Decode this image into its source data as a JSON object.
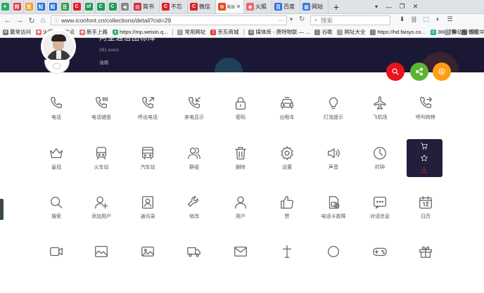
{
  "browser": {
    "tabs": [
      {
        "kind": "narrow",
        "fav": "●",
        "color": "#2aae67",
        "label": ""
      },
      {
        "kind": "narrow",
        "fav": "邦",
        "color": "#e03a3a",
        "label": ""
      },
      {
        "kind": "narrow",
        "fav": "货",
        "color": "#f0a020",
        "label": ""
      },
      {
        "kind": "narrow",
        "fav": "知",
        "color": "#1b6fe0",
        "label": ""
      },
      {
        "kind": "narrow",
        "fav": "知",
        "color": "#1b6fe0",
        "label": ""
      },
      {
        "kind": "narrow",
        "fav": "豆",
        "color": "#2e963d",
        "label": ""
      },
      {
        "kind": "narrow",
        "fav": "C",
        "color": "#d22",
        "label": ""
      },
      {
        "kind": "narrow",
        "fav": "sf",
        "color": "#1a9d55",
        "label": ""
      },
      {
        "kind": "narrow",
        "fav": "C",
        "color": "#1a9d55",
        "label": ""
      },
      {
        "kind": "narrow",
        "fav": "C",
        "color": "#1a9d55",
        "label": ""
      },
      {
        "kind": "narrow",
        "fav": "◀",
        "color": "#888",
        "label": ""
      },
      {
        "kind": "wide",
        "fav": "▤",
        "color": "#c33",
        "label": "简书"
      },
      {
        "kind": "wide",
        "fav": "C",
        "color": "#d22",
        "label": "不忘"
      },
      {
        "kind": "wide",
        "fav": "C",
        "color": "#d22",
        "label": "微信"
      },
      {
        "kind": "active",
        "fav": "✿",
        "color": "#e64a19",
        "label": "Ico"
      },
      {
        "kind": "wide",
        "fav": "◉",
        "color": "#e66",
        "label": "火狐"
      },
      {
        "kind": "wide",
        "fav": "百",
        "color": "#2b6de0",
        "label": "百度"
      },
      {
        "kind": "wide",
        "fav": "▦",
        "color": "#3a7be0",
        "label": "网站"
      }
    ],
    "new_tab": "+",
    "tab_menu": "▾",
    "window_buttons": [
      "—",
      "❐",
      "✕"
    ],
    "url": "www.iconfont.cn/collections/detail?cid=29",
    "search_placeholder": "搜索",
    "toolbar_icons": [
      "⬇",
      "|||",
      "⬚",
      "◐",
      "☰"
    ],
    "bookmarks": [
      {
        "label": "最常访问",
        "color": "#777",
        "icon": "⚙"
      },
      {
        "label": "火狐官方站点",
        "color": "#e66",
        "icon": "◉"
      },
      {
        "label": "新手上路",
        "color": "#e66",
        "icon": "◉"
      },
      {
        "label": "https://mp.weixin.q...",
        "color": "#2aae67",
        "icon": "●"
      },
      {
        "label": "常用网址",
        "color": "#999",
        "icon": "▢"
      },
      {
        "label": "京东商城",
        "color": "#d22",
        "icon": "京"
      },
      {
        "label": "媒体库 - 唐特物联 — ...",
        "color": "#777",
        "icon": "☰"
      },
      {
        "label": "谷歌",
        "color": "#777",
        "icon": "▢"
      },
      {
        "label": "网址大全",
        "color": "#999",
        "icon": "▢"
      },
      {
        "label": "https://hd.faisys.co...",
        "color": "#777",
        "icon": "▢"
      },
      {
        "label": "360搜索",
        "color": "#2a9",
        "icon": "◎"
      },
      {
        "label": "游戏中心",
        "color": "#777",
        "icon": "▢"
      }
    ],
    "bookmark_more": "移动版书签"
  },
  "collection": {
    "title": "阿里通信图标库",
    "count": "261 icons",
    "author": "油烟"
  },
  "actions": [
    {
      "name": "search",
      "color": "#e8131e"
    },
    {
      "name": "share",
      "color": "#5cb531"
    },
    {
      "name": "download",
      "color": "#ff9e12"
    }
  ],
  "icons": [
    {
      "label": "电话",
      "icon": "phone-icon"
    },
    {
      "label": "电话键盘",
      "icon": "phone-keypad-icon"
    },
    {
      "label": "呼出电话",
      "icon": "phone-outgoing-icon"
    },
    {
      "label": "来电显示",
      "icon": "phone-incoming-icon"
    },
    {
      "label": "密码",
      "icon": "lock-icon"
    },
    {
      "label": "出租车",
      "icon": "taxi-icon"
    },
    {
      "label": "灯泡提示",
      "icon": "lightbulb-icon"
    },
    {
      "label": "飞机场",
      "icon": "airplane-icon"
    },
    {
      "label": "呼叫转移",
      "icon": "call-forward-icon"
    },
    {
      "label": "",
      "icon": "blank"
    },
    {
      "label": "皇冠",
      "icon": "crown-icon"
    },
    {
      "label": "火车站",
      "icon": "train-icon"
    },
    {
      "label": "汽车站",
      "icon": "bus-icon"
    },
    {
      "label": "群组",
      "icon": "group-icon"
    },
    {
      "label": "删除",
      "icon": "trash-icon"
    },
    {
      "label": "设置",
      "icon": "gear-icon"
    },
    {
      "label": "声音",
      "icon": "speaker-icon"
    },
    {
      "label": "时钟",
      "icon": "clock-icon"
    },
    {
      "label": "",
      "icon": "blank"
    },
    {
      "label": "",
      "icon": "blank"
    },
    {
      "label": "搜索",
      "icon": "search-icon"
    },
    {
      "label": "添加用户",
      "icon": "add-user-icon"
    },
    {
      "label": "通讯录",
      "icon": "contacts-icon"
    },
    {
      "label": "修改",
      "icon": "wrench-icon"
    },
    {
      "label": "用户",
      "icon": "user-icon"
    },
    {
      "label": "赞",
      "icon": "thumbs-up-icon"
    },
    {
      "label": "电话卡故障",
      "icon": "sim-error-icon"
    },
    {
      "label": "对话信息",
      "icon": "chat-icon"
    },
    {
      "label": "日历",
      "icon": "calendar-icon"
    },
    {
      "label": "",
      "icon": "blank"
    },
    {
      "label": "",
      "icon": "video-icon"
    },
    {
      "label": "",
      "icon": "image-frame-icon"
    },
    {
      "label": "",
      "icon": "photo-icon"
    },
    {
      "label": "",
      "icon": "truck-icon"
    },
    {
      "label": "",
      "icon": "mail-icon"
    },
    {
      "label": "",
      "icon": "cross-icon"
    },
    {
      "label": "",
      "icon": "circle-icon"
    },
    {
      "label": "",
      "icon": "gamepad-icon"
    },
    {
      "label": "",
      "icon": "gift-icon"
    },
    {
      "label": "",
      "icon": "blank"
    }
  ],
  "hover_actions": [
    "add-to-cart-icon",
    "favorite-star-icon",
    "download-icon"
  ],
  "hover_colors": {
    "normal": "#ffffff",
    "accent": "#e8131e"
  }
}
